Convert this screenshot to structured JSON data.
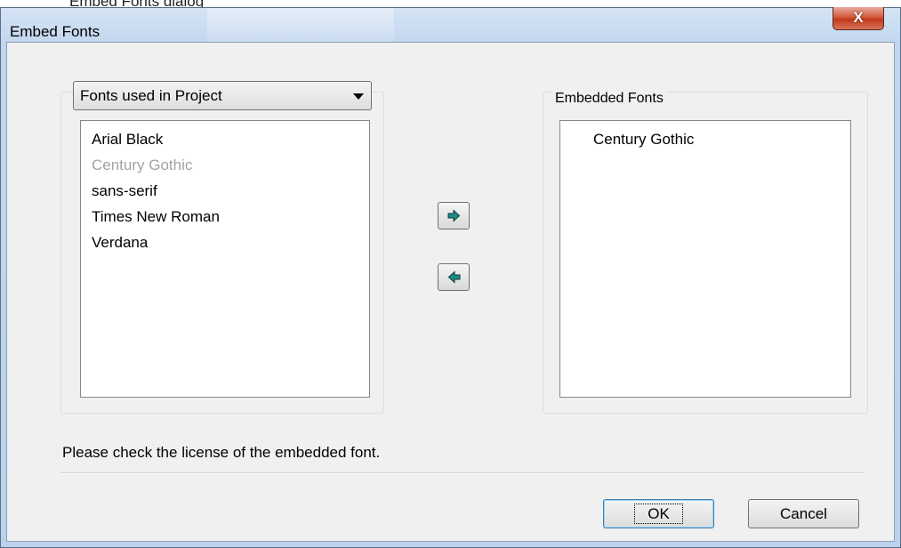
{
  "page_caption": "Embed Fonts dialog",
  "window": {
    "title": "Embed Fonts",
    "close_label": "X"
  },
  "source": {
    "dropdown_selected": "Fonts used in Project",
    "fonts": [
      {
        "label": "Arial Black",
        "disabled": false
      },
      {
        "label": "Century Gothic",
        "disabled": true
      },
      {
        "label": "sans-serif",
        "disabled": false
      },
      {
        "label": "Times New Roman",
        "disabled": false
      },
      {
        "label": "Verdana",
        "disabled": false
      }
    ]
  },
  "embedded": {
    "group_label": "Embedded Fonts",
    "fonts": [
      "Century Gothic"
    ]
  },
  "actions": {
    "add_icon": "arrow-right-icon",
    "remove_icon": "arrow-left-icon"
  },
  "footer": {
    "license_note": "Please check the license of the embedded font.",
    "ok_label": "OK",
    "cancel_label": "Cancel"
  },
  "colors": {
    "arrow_fill": "#1f8a86",
    "disabled_text": "#a3a3a3"
  }
}
